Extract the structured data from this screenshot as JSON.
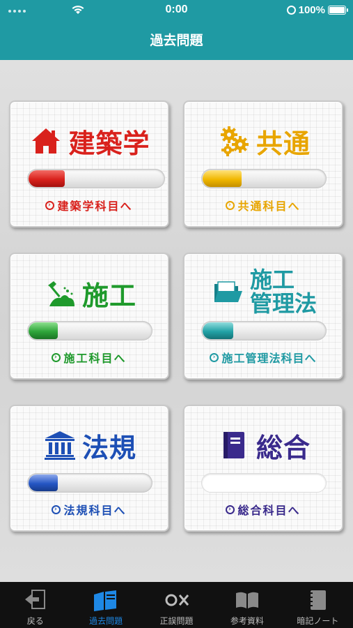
{
  "status": {
    "time": "0:00",
    "battery": "100%"
  },
  "nav": {
    "title": "過去問題"
  },
  "cards": [
    {
      "title": "建築学",
      "link": "建築学科目へ",
      "color": "#d9211c",
      "fill": "#d9211c",
      "progress": 0.3,
      "icon": "house-icon"
    },
    {
      "title": "共通",
      "link": "共通科目へ",
      "color": "#e8a500",
      "fill": "#f0b700",
      "progress": 0.3,
      "icon": "gears-icon"
    },
    {
      "title": "施工",
      "link": "施工科目へ",
      "color": "#1f9a2c",
      "fill": "#2ea53a",
      "progress": 0.25,
      "icon": "shovel-icon"
    },
    {
      "title_lines": [
        "施工",
        "管理法"
      ],
      "link": "施工管理法科目へ",
      "color": "#1f9aa3",
      "fill": "#22a2a6",
      "progress": 0.25,
      "icon": "folder-icon"
    },
    {
      "title": "法規",
      "link": "法規科目へ",
      "color": "#1d4fb5",
      "fill": "#2556c4",
      "progress": 0.25,
      "icon": "courthouse-icon"
    },
    {
      "title": "総合",
      "link": "総合科目へ",
      "color": "#3a2a8c",
      "fill": "#3a2a8c",
      "progress": 0,
      "icon": "book-icon"
    }
  ],
  "tabs": [
    {
      "label": "戻る",
      "icon": "back-icon",
      "active": false
    },
    {
      "label": "過去問題",
      "icon": "books-icon",
      "active": true
    },
    {
      "label": "正誤問題",
      "icon": "ox-icon",
      "active": false
    },
    {
      "label": "参考資料",
      "icon": "open-book-icon",
      "active": false
    },
    {
      "label": "暗記ノート",
      "icon": "notebook-icon",
      "active": false
    }
  ]
}
